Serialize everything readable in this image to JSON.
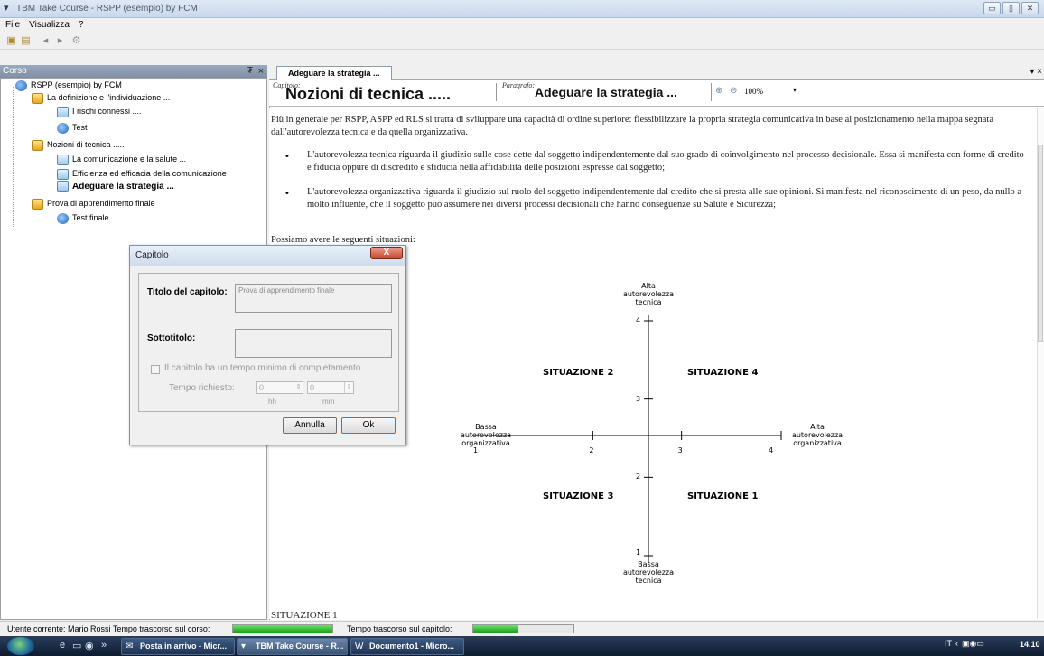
{
  "window": {
    "title": "TBM Take Course - RSPP (esempio) by FCM",
    "buttons": [
      "▭",
      "▯",
      "✕"
    ]
  },
  "menu": [
    "File",
    "Visualizza",
    "?"
  ],
  "left_panel": {
    "header": "Corso",
    "pin": "₮",
    "close": "×",
    "tree": [
      {
        "label": "RSPP (esempio) by FCM",
        "icon": "course-icon"
      },
      {
        "label": "La definizione e l'individuazione ...",
        "icon": "chapter-icon"
      },
      {
        "label": "I rischi connessi ....",
        "icon": "page-icon"
      },
      {
        "label": "Test",
        "icon": "test-icon"
      },
      {
        "label": "Nozioni di tecnica .....",
        "icon": "chapter-icon"
      },
      {
        "label": "La comunicazione e la salute ...",
        "icon": "page-icon"
      },
      {
        "label": "Efficienza ed efficacia della comunicazione",
        "icon": "page-icon"
      },
      {
        "label": "Adeguare la strategia ...",
        "icon": "page-icon"
      },
      {
        "label": "Prova di apprendimento finale",
        "icon": "chapter-icon"
      },
      {
        "label": "Test finale",
        "icon": "test-icon"
      }
    ]
  },
  "tab": {
    "label": "Adeguare la strategia ...",
    "menu": "▾ ×"
  },
  "header": {
    "capitolo_label": "Capitolo:",
    "capitolo_title": "Nozioni di tecnica .....",
    "paragrafo_label": "Paragrafo:",
    "paragrafo_title": "Adeguare la strategia ...",
    "zoom": "100%",
    "zoom_dd": "▾"
  },
  "content": {
    "para1": "Più in generale per RSPP, ASPP ed RLS si tratta di sviluppare una capacità di ordine superiore: flessibilizzare la propria strategia comunicativa in base al posizionamento nella mappa segnata dall'autorevolezza tecnica e da quella organizzativa.",
    "bullet1": "L'autorevolezza tecnica riguarda il giudizio sulle cose dette dal soggetto indipendentemente dal suo grado di coinvolgimento nel processo decisionale. Essa si manifesta con forme di credito e fiducia oppure di discredito e sfiducia nella affidabilità delle posizioni espresse dal soggetto;",
    "bullet2": "L'autorevolezza organizzativa riguarda il giudizio sul ruolo del soggetto indipendentemente dal credito che si presta alle sue opinioni. Si manifesta nel riconoscimento di un peso, da nullo a molto influente, che il soggetto può assumere nei diversi processi decisionali che hanno conseguenze su Salute e Sicurezza;",
    "para2": "Possiamo avere le seguenti situazioni:",
    "para3": "SITUAZIONE 1",
    "bullet_char": "•"
  },
  "chart_data": {
    "type": "scatter",
    "title": "",
    "x_axis": {
      "range": [
        1,
        4
      ],
      "ticks": [
        "1",
        "2",
        "3",
        "4"
      ],
      "low_label": "Bassa\nautorevolezza\norganizzativa",
      "high_label": "Alta\nautorevolezza\norganizzativa"
    },
    "y_axis": {
      "range": [
        1,
        4
      ],
      "ticks": [
        "1",
        "2",
        "3",
        "4"
      ],
      "low_label": "Bassa\nautorevolezza\ntecnica",
      "high_label": "Alta\nautorevolezza\ntecnica"
    },
    "quadrants": [
      {
        "label": "SITUAZIONE 2",
        "position": "top-left"
      },
      {
        "label": "SITUAZIONE 4",
        "position": "top-right"
      },
      {
        "label": "SITUAZIONE 3",
        "position": "bottom-left"
      },
      {
        "label": "SITUAZIONE 1",
        "position": "bottom-right"
      }
    ]
  },
  "dialog": {
    "title": "Capitolo",
    "close": "X",
    "titolo_label": "Titolo del capitolo:",
    "titolo_value": "Prova di apprendimento finale",
    "sottotitolo_label": "Sottotitolo:",
    "sottotitolo_value": "",
    "checkbox_label": "Il capitolo ha un tempo minimo di completamento",
    "tempo_label": "Tempo richiesto:",
    "hh_value": "0",
    "mm_value": "0",
    "hh_unit": "hh",
    "mm_unit": "mm",
    "cancel": "Annulla",
    "ok": "Ok"
  },
  "status": {
    "user": "Utente corrente: Mario Rossi  Tempo trascorso sul corso:",
    "course_progress": 1.0,
    "chapter_label": "Tempo trascorso sul capitolo:",
    "chapter_progress": 0.45
  },
  "taskbar": {
    "quick": [
      "»"
    ],
    "tasks": [
      "Posta in arrivo - Micr...",
      "TBM Take Course - R...",
      "Documento1 - Micro..."
    ],
    "tray_lang": "IT",
    "tray_arrow": "‹",
    "clock": "14.10"
  },
  "colors": {
    "accent": "#2a66b8",
    "progress": "#18a018"
  }
}
